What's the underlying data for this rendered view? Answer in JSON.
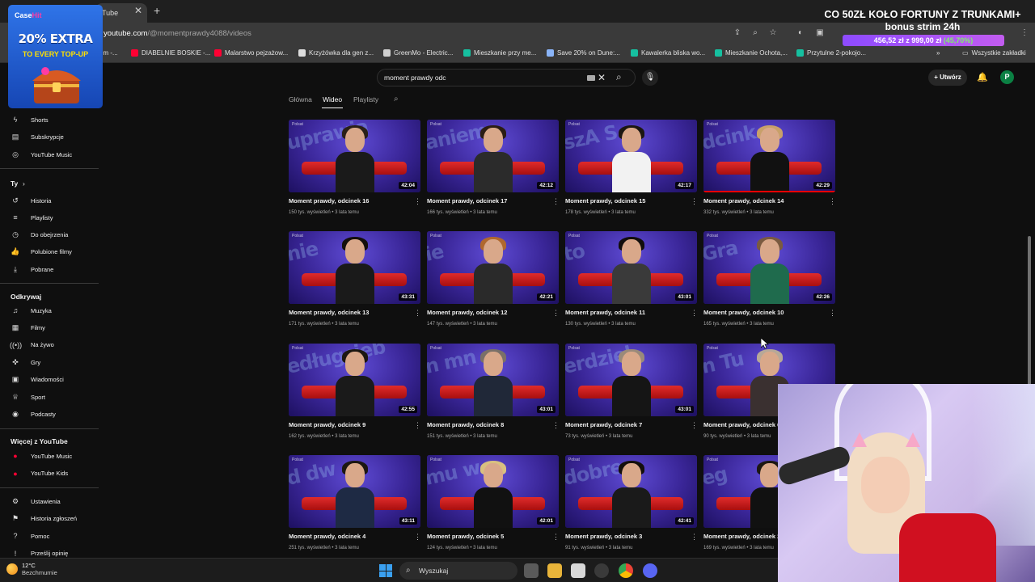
{
  "browser": {
    "tab_title": "Tube",
    "url_host": "youtube.com",
    "url_path": "/@momentprawdy4088/videos",
    "bookmarks": [
      {
        "label": "um -...",
        "color": "#1a73e8"
      },
      {
        "label": "DIABELNIE BOSKIE -...",
        "color": "#ff0033"
      },
      {
        "label": "Malarstwo pejzażow...",
        "color": "#ff0033"
      },
      {
        "label": "Krzyżówka dla gen z...",
        "color": "#dddddd"
      },
      {
        "label": "GreenMo - Electric...",
        "color": "#cfcfcf"
      },
      {
        "label": "Mieszkanie przy me...",
        "color": "#16c0a0"
      },
      {
        "label": "Save 20% on Dune:...",
        "color": "#8ab4f8"
      },
      {
        "label": "Kawalerka bliska wo...",
        "color": "#16c0a0"
      },
      {
        "label": "Mieszkanie Ochota,...",
        "color": "#16c0a0"
      },
      {
        "label": "Przytulne 2-pokojo...",
        "color": "#16c0a0"
      }
    ],
    "all_bookmarks": "Wszystkie zakładki"
  },
  "overlay": {
    "promo_brand": "Case",
    "promo_brand_accent": "Hit",
    "promo_big": "20% EXTRA",
    "promo_small": "TO EVERY TOP-UP",
    "banner_line1": "CO 50ZŁ KOŁO FORTUNY Z TRUNKAMI+",
    "banner_line2": "bonus strim 24h",
    "banner_progress": "456,52 zł z 999,00 zł",
    "banner_percent": "(45,70%)",
    "banner_fill": 0.457
  },
  "header": {
    "search_query": "moment prawdy odc",
    "create_label": "Utwórz",
    "avatar_letter": "P"
  },
  "sidebar": {
    "top_items": [
      {
        "label": "Shorts",
        "icon": "shorts-icon",
        "glyph": "ϟ"
      },
      {
        "label": "Subskrypcje",
        "icon": "subscriptions-icon",
        "glyph": "▤"
      },
      {
        "label": "YouTube Music",
        "icon": "music-icon",
        "glyph": "◎"
      }
    ],
    "you_header": "Ty",
    "you_items": [
      {
        "label": "Historia",
        "icon": "history-icon",
        "glyph": "↺"
      },
      {
        "label": "Playlisty",
        "icon": "playlists-icon",
        "glyph": "≡"
      },
      {
        "label": "Do obejrzenia",
        "icon": "watch-later-icon",
        "glyph": "◷"
      },
      {
        "label": "Polubione filmy",
        "icon": "liked-icon",
        "glyph": "👍"
      },
      {
        "label": "Pobrane",
        "icon": "download-icon",
        "glyph": "⤓"
      }
    ],
    "explore_header": "Odkrywaj",
    "explore_items": [
      {
        "label": "Muzyka",
        "icon": "music-note-icon",
        "glyph": "♫"
      },
      {
        "label": "Filmy",
        "icon": "film-icon",
        "glyph": "▦"
      },
      {
        "label": "Na żywo",
        "icon": "live-icon",
        "glyph": "((•))"
      },
      {
        "label": "Gry",
        "icon": "gamepad-icon",
        "glyph": "✜"
      },
      {
        "label": "Wiadomości",
        "icon": "news-icon",
        "glyph": "▣"
      },
      {
        "label": "Sport",
        "icon": "trophy-icon",
        "glyph": "♕"
      },
      {
        "label": "Podcasty",
        "icon": "podcast-icon",
        "glyph": "◉"
      }
    ],
    "more_header": "Więcej z YouTube",
    "more_items": [
      {
        "label": "YouTube Music",
        "icon": "youtube-music-icon",
        "glyph": "●"
      },
      {
        "label": "YouTube Kids",
        "icon": "youtube-kids-icon",
        "glyph": "●"
      }
    ],
    "bottom_items": [
      {
        "label": "Ustawienia",
        "icon": "settings-icon",
        "glyph": "⚙"
      },
      {
        "label": "Historia zgłoszeń",
        "icon": "flag-icon",
        "glyph": "⚑"
      },
      {
        "label": "Pomoc",
        "icon": "help-icon",
        "glyph": "?"
      },
      {
        "label": "Prześlij opinię",
        "icon": "feedback-icon",
        "glyph": "!"
      }
    ]
  },
  "channel_tabs": [
    "Główna",
    "Wideo",
    "Playlisty"
  ],
  "videos": [
    {
      "title": "Moment prawdy, odcinek 16",
      "meta": "150 tys. wyświetleń • 3 lata temu",
      "duration": "42:04",
      "text": "uprawia",
      "hair": "#2a2018",
      "body": "#1a1a1a"
    },
    {
      "title": "Moment prawdy, odcinek 17",
      "meta": "166 tys. wyświetleń • 3 lata temu",
      "duration": "42:12",
      "text": "aniem",
      "hair": "#2b1d14",
      "body": "#2b2b2b"
    },
    {
      "title": "Moment prawdy, odcinek 15",
      "meta": "178 tys. wyświetleń • 3 lata temu",
      "duration": "42:17",
      "text": "szA S",
      "hair": "#1c1712",
      "body": "#f2f2f2"
    },
    {
      "title": "Moment prawdy, odcinek 14",
      "meta": "332 tys. wyświetleń • 3 lata temu",
      "duration": "42:29",
      "text": "dcink",
      "hair": "#c8a06a",
      "body": "#111111",
      "progress": 1
    },
    {
      "title": "Moment prawdy, odcinek 13",
      "meta": "171 tys. wyświetleń • 3 lata temu",
      "duration": "43:31",
      "text": "nie",
      "hair": "#140f0c",
      "body": "#1a1a1a"
    },
    {
      "title": "Moment prawdy, odcinek 12",
      "meta": "147 tys. wyświetleń • 3 lata temu",
      "duration": "42:21",
      "text": "ie",
      "hair": "#b0682e",
      "body": "#2a2a2a"
    },
    {
      "title": "Moment prawdy, odcinek 11",
      "meta": "130 tys. wyświetleń • 3 lata temu",
      "duration": "43:01",
      "text": "to",
      "hair": "#120e0c",
      "body": "#3a3a3a"
    },
    {
      "title": "Moment prawdy, odcinek 10",
      "meta": "165 tys. wyświetleń • 3 lata temu",
      "duration": "42:26",
      "text": "Gra",
      "hair": "#7a5a40",
      "body": "#1f6b4d"
    },
    {
      "title": "Moment prawdy, odcinek 9",
      "meta": "162 tys. wyświetleń • 3 lata temu",
      "duration": "42:55",
      "text": "edługcieb",
      "hair": "#1c1712",
      "body": "#1a1a1a"
    },
    {
      "title": "Moment prawdy, odcinek 8",
      "meta": "151 tys. wyświetleń • 3 lata temu",
      "duration": "43:01",
      "text": "n mn",
      "hair": "#7a7068",
      "body": "#202838"
    },
    {
      "title": "Moment prawdy, odcinek 7",
      "meta": "73 tys. wyświetleń • 3 lata temu",
      "duration": "43:01",
      "text": "erdziel",
      "hair": "#9a8a7a",
      "body": "#151515"
    },
    {
      "title": "Moment prawdy, odcinek 6",
      "meta": "90 tys. wyświetleń • 3 lata temu",
      "duration": "43:04",
      "text": "n Tu",
      "hair": "#b7a898",
      "body": "#3a3030"
    },
    {
      "title": "Moment prawdy, odcinek 4",
      "meta": "251 tys. wyświetleń • 3 lata temu",
      "duration": "43:11",
      "text": "d dw",
      "hair": "#1c1712",
      "body": "#1e2a44"
    },
    {
      "title": "Moment prawdy, odcinek 5",
      "meta": "124 tys. wyświetleń • 3 lata temu",
      "duration": "42:01",
      "text": "mu w",
      "hair": "#d8c080",
      "body": "#111111"
    },
    {
      "title": "Moment prawdy, odcinek 3",
      "meta": "91 tys. wyświetleń • 3 lata temu",
      "duration": "42:41",
      "text": "dobre",
      "hair": "#140f0c",
      "body": "#1a1a1a"
    },
    {
      "title": "Moment prawdy, odcinek 2",
      "meta": "169 tys. wyświetleń • 3 lata temu",
      "duration": "42:40",
      "text": "eg",
      "hair": "#1c1712",
      "body": "#111111"
    }
  ],
  "taskbar": {
    "temperature": "12°C",
    "weather": "Bezchmurnie",
    "search_placeholder": "Wyszukaj"
  }
}
